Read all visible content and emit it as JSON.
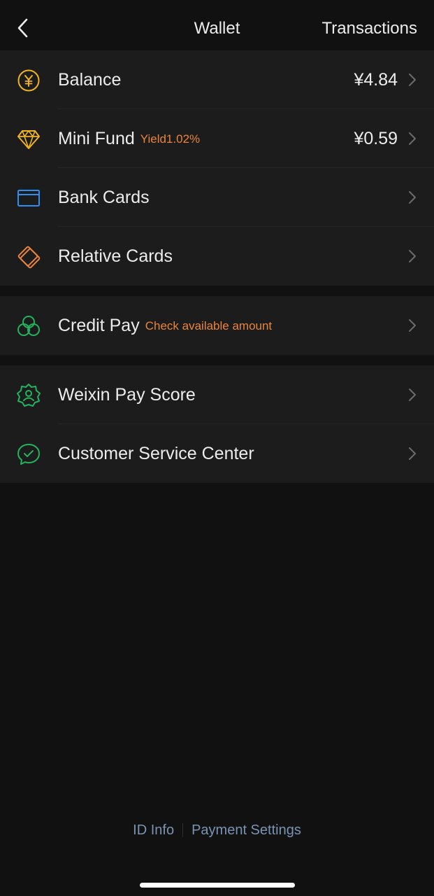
{
  "header": {
    "title": "Wallet",
    "action": "Transactions"
  },
  "colors": {
    "background": "#111111",
    "group_background": "#1c1c1c",
    "accent_orange": "#e8843b",
    "gold": "#f0b323",
    "blue": "#2f8ff0",
    "green": "#22b35e",
    "link": "#7b93b2"
  },
  "group1": {
    "balance": {
      "label": "Balance",
      "value": "¥4.84",
      "icon": "yuan-coin-icon"
    },
    "mini_fund": {
      "label": "Mini Fund",
      "sub": "Yield1.02%",
      "value": "¥0.59",
      "icon": "diamond-icon"
    },
    "bank_cards": {
      "label": "Bank Cards",
      "icon": "bank-card-icon"
    },
    "relative_cards": {
      "label": "Relative Cards",
      "icon": "relative-card-icon"
    }
  },
  "group2": {
    "credit_pay": {
      "label": "Credit Pay",
      "sub": "Check available amount",
      "icon": "credit-pay-icon"
    }
  },
  "group3": {
    "pay_score": {
      "label": "Weixin Pay Score",
      "icon": "pay-score-badge-icon"
    },
    "customer_service": {
      "label": "Customer Service Center",
      "icon": "customer-service-icon"
    }
  },
  "footer": {
    "id_info": "ID Info",
    "payment_settings": "Payment Settings"
  }
}
